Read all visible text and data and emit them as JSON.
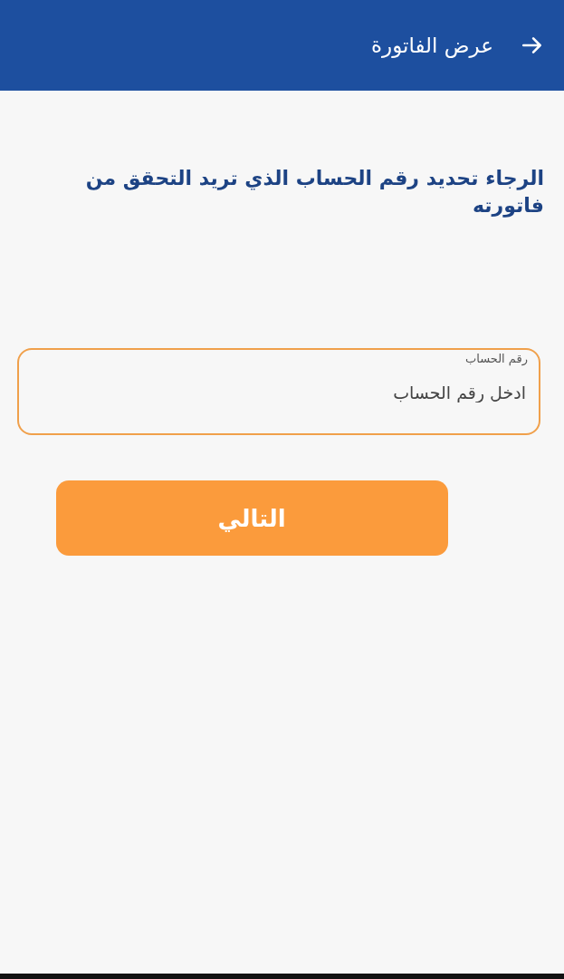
{
  "app_bar": {
    "title": "عرض الفاتورة"
  },
  "prompt": "الرجاء تحديد رقم الحساب الذي تريد التحقق من فاتورته",
  "account_field": {
    "label": "رقم الحساب",
    "placeholder": "ادخل رقم الحساب"
  },
  "next_button": {
    "label": "التالي"
  }
}
